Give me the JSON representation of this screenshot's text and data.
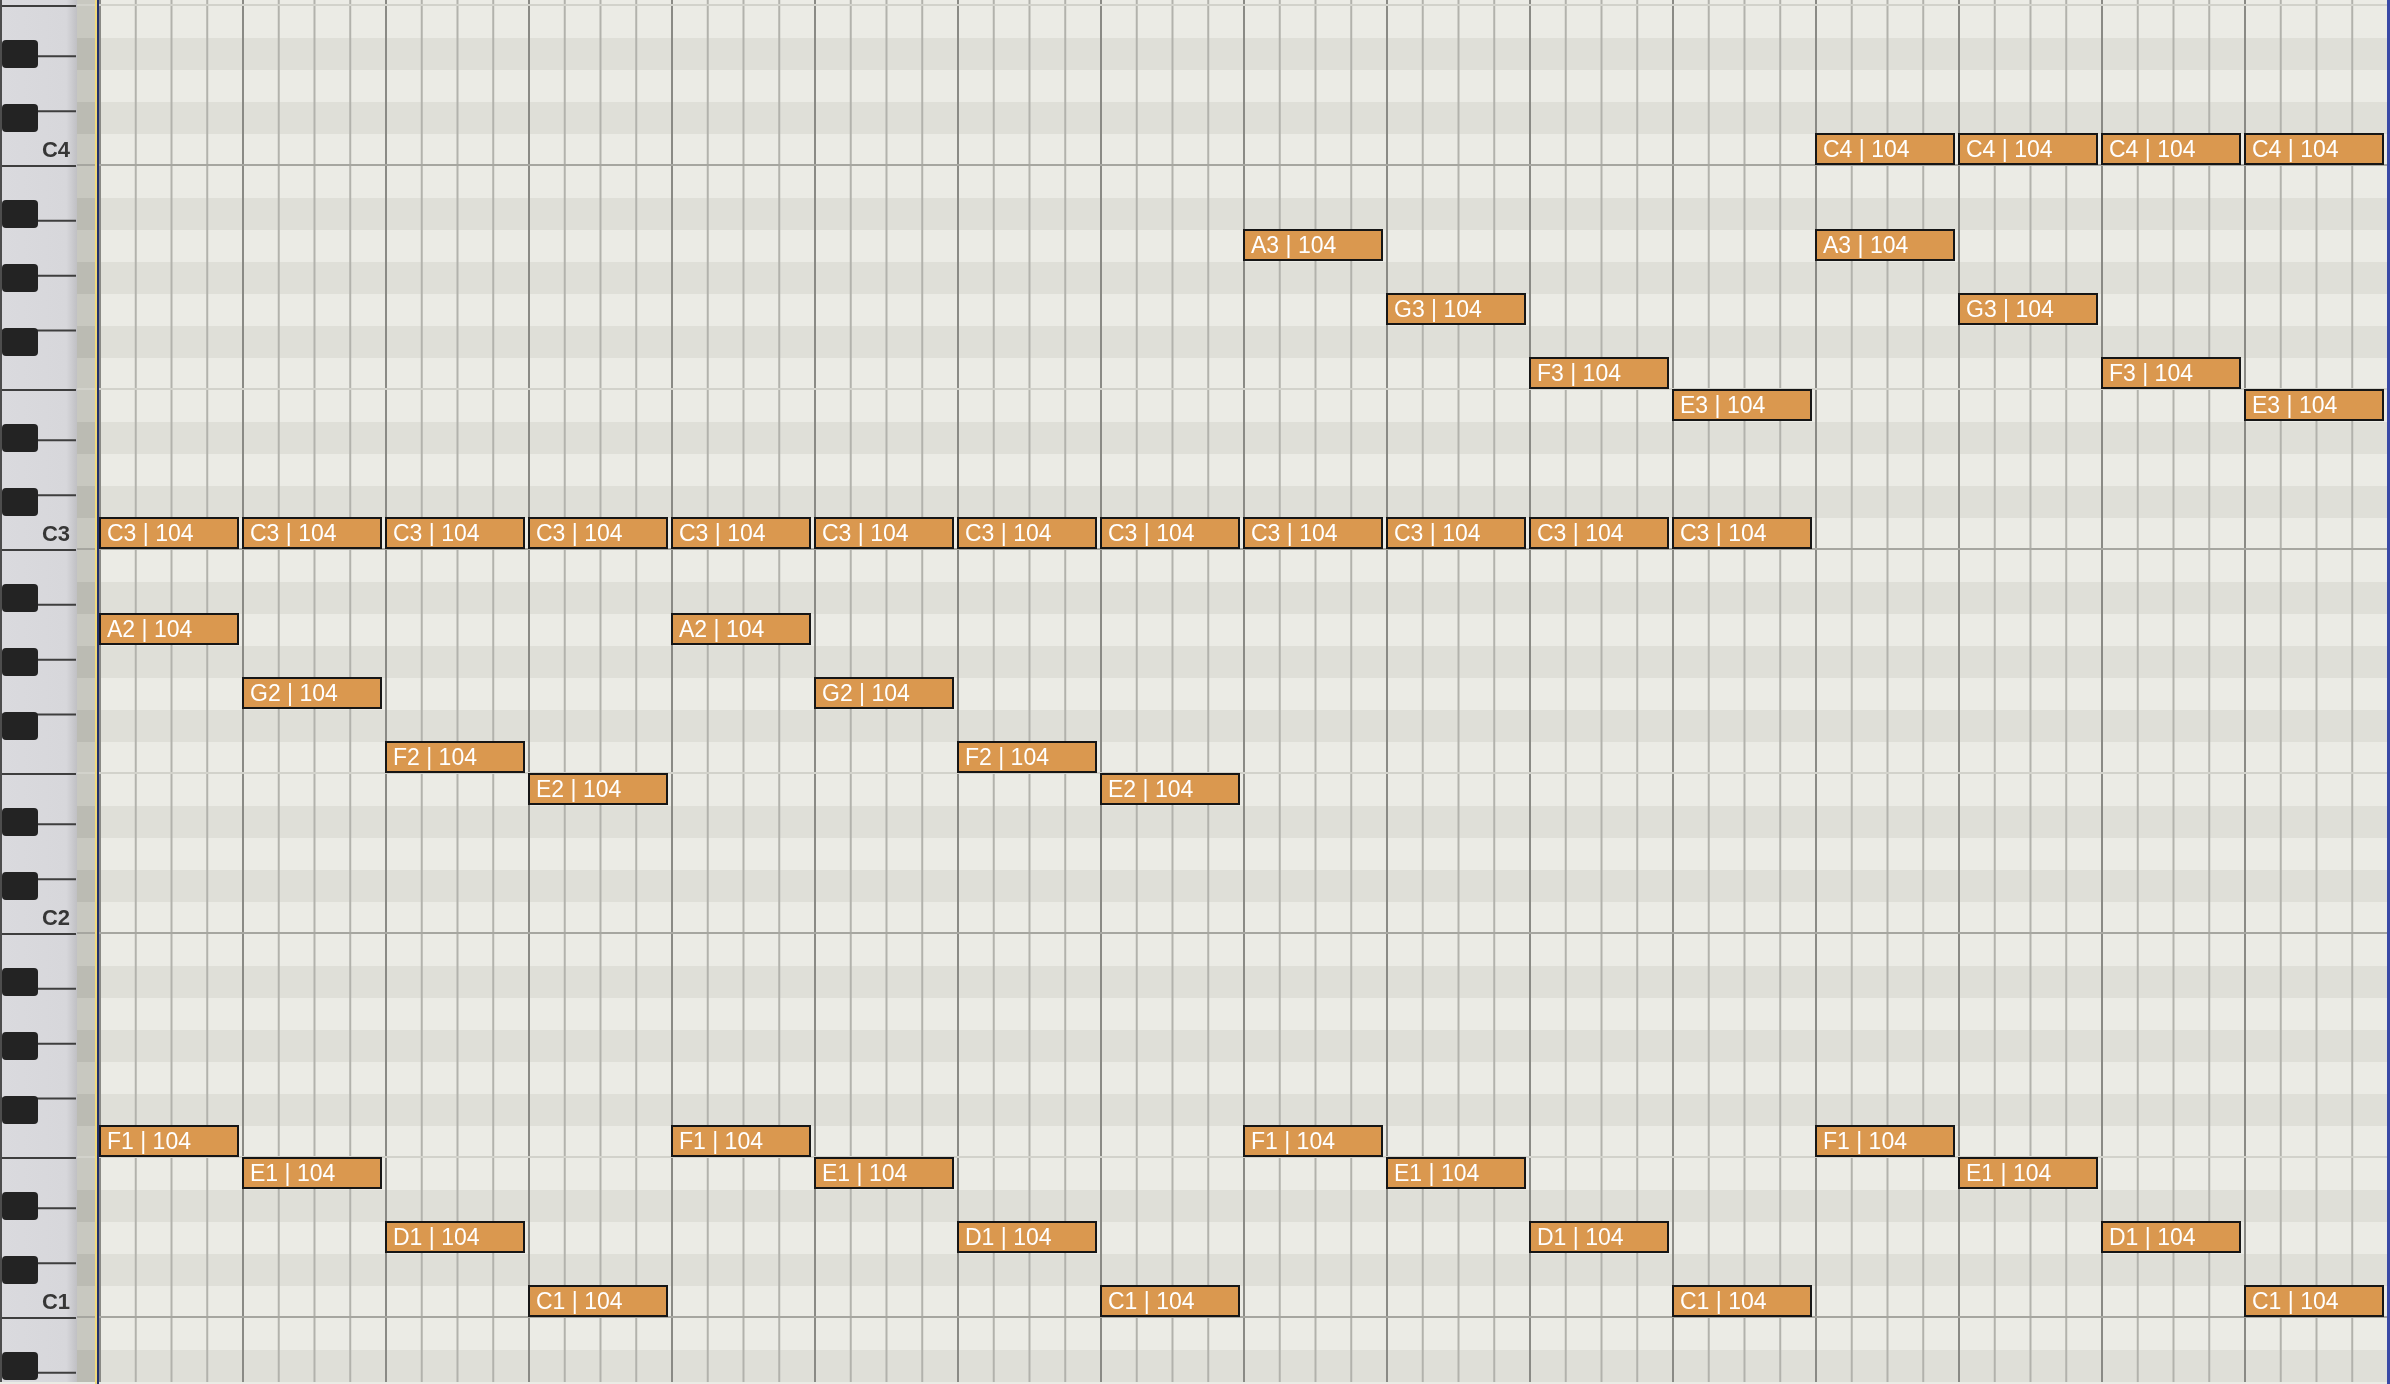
{
  "piano_roll": {
    "lanes": [
      {
        "kind": "break"
      },
      {
        "kind": "white"
      },
      {
        "kind": "black"
      },
      {
        "kind": "white"
      },
      {
        "kind": "black"
      },
      {
        "kind": "octave",
        "key_label": "C4",
        "slots": [
          {
            "kind": "rest"
          },
          {
            "kind": "rest"
          },
          {
            "kind": "rest"
          },
          {
            "kind": "rest"
          },
          {
            "kind": "rest"
          },
          {
            "kind": "rest"
          },
          {
            "kind": "rest"
          },
          {
            "kind": "rest"
          },
          {
            "kind": "rest"
          },
          {
            "kind": "rest"
          },
          {
            "kind": "rest"
          },
          {
            "kind": "rest"
          },
          {
            "kind": "note",
            "label": "C4 | 104"
          },
          {
            "kind": "note",
            "label": "C4 | 104"
          },
          {
            "kind": "note",
            "label": "C4 | 104"
          },
          {
            "kind": "note",
            "label": "C4 | 104"
          }
        ]
      },
      {
        "kind": "white"
      },
      {
        "kind": "black"
      },
      {
        "kind": "white",
        "slots": [
          {
            "kind": "rest"
          },
          {
            "kind": "rest"
          },
          {
            "kind": "rest"
          },
          {
            "kind": "rest"
          },
          {
            "kind": "rest"
          },
          {
            "kind": "rest"
          },
          {
            "kind": "rest"
          },
          {
            "kind": "rest"
          },
          {
            "kind": "note",
            "label": "A3 | 104"
          },
          {
            "kind": "rest"
          },
          {
            "kind": "rest"
          },
          {
            "kind": "rest"
          },
          {
            "kind": "note",
            "label": "A3 | 104"
          }
        ]
      },
      {
        "kind": "black"
      },
      {
        "kind": "white",
        "slots": [
          {
            "kind": "rest"
          },
          {
            "kind": "rest"
          },
          {
            "kind": "rest"
          },
          {
            "kind": "rest"
          },
          {
            "kind": "rest"
          },
          {
            "kind": "rest"
          },
          {
            "kind": "rest"
          },
          {
            "kind": "rest"
          },
          {
            "kind": "rest"
          },
          {
            "kind": "note",
            "label": "G3 | 104"
          },
          {
            "kind": "rest"
          },
          {
            "kind": "rest"
          },
          {
            "kind": "rest"
          },
          {
            "kind": "note",
            "label": "G3 | 104"
          }
        ]
      },
      {
        "kind": "black"
      },
      {
        "kind": "break",
        "slots": [
          {
            "kind": "rest"
          },
          {
            "kind": "rest"
          },
          {
            "kind": "rest"
          },
          {
            "kind": "rest"
          },
          {
            "kind": "rest"
          },
          {
            "kind": "rest"
          },
          {
            "kind": "rest"
          },
          {
            "kind": "rest"
          },
          {
            "kind": "rest"
          },
          {
            "kind": "rest"
          },
          {
            "kind": "note",
            "label": "F3 | 104"
          },
          {
            "kind": "rest"
          },
          {
            "kind": "rest"
          },
          {
            "kind": "rest"
          },
          {
            "kind": "note",
            "label": "F3 | 104"
          }
        ]
      },
      {
        "kind": "white",
        "slots": [
          {
            "kind": "rest"
          },
          {
            "kind": "rest"
          },
          {
            "kind": "rest"
          },
          {
            "kind": "rest"
          },
          {
            "kind": "rest"
          },
          {
            "kind": "rest"
          },
          {
            "kind": "rest"
          },
          {
            "kind": "rest"
          },
          {
            "kind": "rest"
          },
          {
            "kind": "rest"
          },
          {
            "kind": "rest"
          },
          {
            "kind": "note",
            "label": "E3 | 104"
          },
          {
            "kind": "rest"
          },
          {
            "kind": "rest"
          },
          {
            "kind": "rest"
          },
          {
            "kind": "note",
            "label": "E3 | 104"
          }
        ]
      },
      {
        "kind": "black"
      },
      {
        "kind": "white"
      },
      {
        "kind": "black"
      },
      {
        "kind": "octave",
        "key_label": "C3",
        "slots": [
          {
            "kind": "note",
            "label": "C3 | 104"
          },
          {
            "kind": "note",
            "label": "C3 | 104"
          },
          {
            "kind": "note",
            "label": "C3 | 104"
          },
          {
            "kind": "note",
            "label": "C3 | 104"
          },
          {
            "kind": "note",
            "label": "C3 | 104"
          },
          {
            "kind": "note",
            "label": "C3 | 104"
          },
          {
            "kind": "note",
            "label": "C3 | 104"
          },
          {
            "kind": "note",
            "label": "C3 | 104"
          },
          {
            "kind": "note",
            "label": "C3 | 104"
          },
          {
            "kind": "note",
            "label": "C3 | 104"
          },
          {
            "kind": "note",
            "label": "C3 | 104"
          },
          {
            "kind": "note",
            "label": "C3 | 104"
          }
        ]
      },
      {
        "kind": "white"
      },
      {
        "kind": "black"
      },
      {
        "kind": "white",
        "slots": [
          {
            "kind": "note",
            "label": "A2 | 104"
          },
          {
            "kind": "rest"
          },
          {
            "kind": "rest"
          },
          {
            "kind": "rest"
          },
          {
            "kind": "note",
            "label": "A2 | 104"
          }
        ]
      },
      {
        "kind": "black"
      },
      {
        "kind": "white",
        "slots": [
          {
            "kind": "rest"
          },
          {
            "kind": "note",
            "label": "G2 | 104"
          },
          {
            "kind": "rest"
          },
          {
            "kind": "rest"
          },
          {
            "kind": "rest"
          },
          {
            "kind": "note",
            "label": "G2 | 104"
          }
        ]
      },
      {
        "kind": "black"
      },
      {
        "kind": "break",
        "slots": [
          {
            "kind": "rest"
          },
          {
            "kind": "rest"
          },
          {
            "kind": "note",
            "label": "F2 | 104"
          },
          {
            "kind": "rest"
          },
          {
            "kind": "rest"
          },
          {
            "kind": "rest"
          },
          {
            "kind": "note",
            "label": "F2 | 104"
          }
        ]
      },
      {
        "kind": "white",
        "slots": [
          {
            "kind": "rest"
          },
          {
            "kind": "rest"
          },
          {
            "kind": "rest"
          },
          {
            "kind": "note",
            "label": "E2 | 104"
          },
          {
            "kind": "rest"
          },
          {
            "kind": "rest"
          },
          {
            "kind": "rest"
          },
          {
            "kind": "note",
            "label": "E2 | 104"
          }
        ]
      },
      {
        "kind": "black"
      },
      {
        "kind": "white"
      },
      {
        "kind": "black"
      },
      {
        "kind": "octave",
        "key_label": "C2"
      },
      {
        "kind": "white"
      },
      {
        "kind": "black"
      },
      {
        "kind": "white"
      },
      {
        "kind": "black"
      },
      {
        "kind": "white"
      },
      {
        "kind": "black"
      },
      {
        "kind": "break",
        "slots": [
          {
            "kind": "note",
            "label": "F1 | 104"
          },
          {
            "kind": "rest"
          },
          {
            "kind": "rest"
          },
          {
            "kind": "rest"
          },
          {
            "kind": "note",
            "label": "F1 | 104"
          },
          {
            "kind": "rest"
          },
          {
            "kind": "rest"
          },
          {
            "kind": "rest"
          },
          {
            "kind": "note",
            "label": "F1 | 104"
          },
          {
            "kind": "rest"
          },
          {
            "kind": "rest"
          },
          {
            "kind": "rest"
          },
          {
            "kind": "note",
            "label": "F1 | 104"
          }
        ]
      },
      {
        "kind": "white",
        "slots": [
          {
            "kind": "rest"
          },
          {
            "kind": "note",
            "label": "E1 | 104"
          },
          {
            "kind": "rest"
          },
          {
            "kind": "rest"
          },
          {
            "kind": "rest"
          },
          {
            "kind": "note",
            "label": "E1 | 104"
          },
          {
            "kind": "rest"
          },
          {
            "kind": "rest"
          },
          {
            "kind": "rest"
          },
          {
            "kind": "note",
            "label": "E1 | 104"
          },
          {
            "kind": "rest"
          },
          {
            "kind": "rest"
          },
          {
            "kind": "rest"
          },
          {
            "kind": "note",
            "label": "E1 | 104"
          }
        ]
      },
      {
        "kind": "black"
      },
      {
        "kind": "white",
        "slots": [
          {
            "kind": "rest"
          },
          {
            "kind": "rest"
          },
          {
            "kind": "note",
            "label": "D1 | 104"
          },
          {
            "kind": "rest"
          },
          {
            "kind": "rest"
          },
          {
            "kind": "rest"
          },
          {
            "kind": "note",
            "label": "D1 | 104"
          },
          {
            "kind": "rest"
          },
          {
            "kind": "rest"
          },
          {
            "kind": "rest"
          },
          {
            "kind": "note",
            "label": "D1 | 104"
          },
          {
            "kind": "rest"
          },
          {
            "kind": "rest"
          },
          {
            "kind": "rest"
          },
          {
            "kind": "note",
            "label": "D1 | 104"
          }
        ]
      },
      {
        "kind": "black"
      },
      {
        "kind": "octave",
        "key_label": "C1",
        "slots": [
          {
            "kind": "rest"
          },
          {
            "kind": "rest"
          },
          {
            "kind": "rest"
          },
          {
            "kind": "note",
            "label": "C1 | 104"
          },
          {
            "kind": "rest"
          },
          {
            "kind": "rest"
          },
          {
            "kind": "rest"
          },
          {
            "kind": "note",
            "label": "C1 | 104"
          },
          {
            "kind": "rest"
          },
          {
            "kind": "rest"
          },
          {
            "kind": "rest"
          },
          {
            "kind": "note",
            "label": "C1 | 104"
          },
          {
            "kind": "rest"
          },
          {
            "kind": "rest"
          },
          {
            "kind": "rest"
          },
          {
            "kind": "note",
            "label": "C1 | 104"
          }
        ]
      },
      {
        "kind": "white"
      },
      {
        "kind": "black"
      }
    ]
  }
}
